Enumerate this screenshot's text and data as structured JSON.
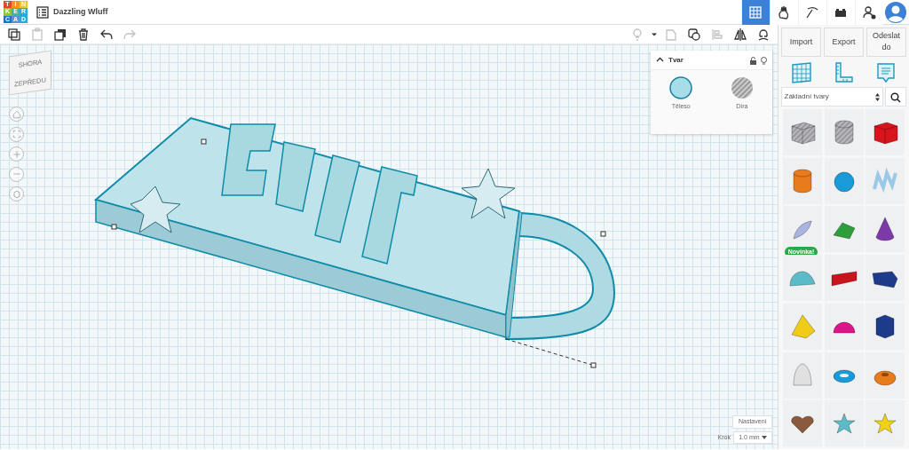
{
  "header": {
    "logo": [
      {
        "letter": "T",
        "color": "#e8432f"
      },
      {
        "letter": "I",
        "color": "#f7941d"
      },
      {
        "letter": "N",
        "color": "#f5c518"
      },
      {
        "letter": "K",
        "color": "#8cc63f"
      },
      {
        "letter": "E",
        "color": "#3cb4a0"
      },
      {
        "letter": "R",
        "color": "#27a9e1"
      },
      {
        "letter": "C",
        "color": "#1c75bc"
      },
      {
        "letter": "A",
        "color": "#5d8fd4"
      },
      {
        "letter": "D",
        "color": "#2aa9d8"
      }
    ],
    "project_title": "Dazzling Wluff",
    "modes": [
      {
        "kind": "grid",
        "selected": true
      },
      {
        "kind": "hand",
        "selected": false
      },
      {
        "kind": "pickaxe",
        "selected": false
      },
      {
        "kind": "brick",
        "selected": false
      },
      {
        "kind": "user-add",
        "selected": false
      }
    ]
  },
  "toolbar": {
    "left": [
      {
        "kind": "copy",
        "disabled": false
      },
      {
        "kind": "paste",
        "disabled": true
      },
      {
        "kind": "duplicate",
        "disabled": false
      },
      {
        "kind": "delete",
        "disabled": false
      },
      {
        "kind": "undo",
        "disabled": false
      },
      {
        "kind": "redo",
        "disabled": true
      }
    ],
    "right": [
      {
        "kind": "bulb",
        "disabled": true
      },
      {
        "kind": "caret",
        "disabled": false
      },
      {
        "kind": "group",
        "disabled": true
      },
      {
        "kind": "ungroup",
        "disabled": false
      },
      {
        "kind": "align",
        "disabled": true
      },
      {
        "kind": "mirror",
        "disabled": false
      },
      {
        "kind": "magnet",
        "disabled": false
      }
    ],
    "actions": [
      "Import",
      "Export",
      "Odeslat do"
    ]
  },
  "inspector": {
    "title": "Tvar",
    "options": [
      {
        "label": "Těleso",
        "kind": "solid",
        "selected": true
      },
      {
        "label": "Díra",
        "kind": "hole",
        "selected": false
      }
    ]
  },
  "view_cube": {
    "top": "SHORA",
    "front": "ZEPŘEDU"
  },
  "nav_controls": [
    {
      "kind": "home"
    },
    {
      "kind": "fit"
    },
    {
      "kind": "zoom-in"
    },
    {
      "kind": "zoom-out"
    },
    {
      "kind": "perspective"
    }
  ],
  "footer": {
    "settings": "Nastavení",
    "step_label": "Krok",
    "step_value": "1.0 mm"
  },
  "library": {
    "tabs": [
      {
        "kind": "workplane"
      },
      {
        "kind": "ruler"
      },
      {
        "kind": "notes"
      }
    ],
    "category": "Základní tvary",
    "shapes": [
      {
        "kind": "box",
        "color": "#b8b8be",
        "hatched": true
      },
      {
        "kind": "cylinder",
        "color": "#b8b8be",
        "hatched": true
      },
      {
        "kind": "box",
        "color": "#d8141d",
        "hatched": false
      },
      {
        "kind": "cylinder",
        "color": "#e87b1c",
        "hatched": false
      },
      {
        "kind": "sphere",
        "color": "#1a9ad6",
        "hatched": false
      },
      {
        "kind": "scribble",
        "color": "#9cc8e8",
        "hatched": false
      },
      {
        "kind": "pen",
        "color": "#a9b4e0",
        "hatched": false,
        "badge": "Novinka!"
      },
      {
        "kind": "roof",
        "color": "#2e9e3a",
        "hatched": false
      },
      {
        "kind": "cone",
        "color": "#7b3aa8",
        "hatched": false
      },
      {
        "kind": "halfcyl",
        "color": "#5bbcc8",
        "hatched": false
      },
      {
        "kind": "text",
        "color": "#c8141d",
        "hatched": false
      },
      {
        "kind": "wedge",
        "color": "#1e3a8a",
        "hatched": false
      },
      {
        "kind": "pyramid",
        "color": "#f0cc18",
        "hatched": false
      },
      {
        "kind": "hemisphere",
        "color": "#e0148a",
        "hatched": false
      },
      {
        "kind": "prism",
        "color": "#1e3a8a",
        "hatched": false
      },
      {
        "kind": "paraboloid",
        "color": "#e0e0e0",
        "hatched": false
      },
      {
        "kind": "torus",
        "color": "#1a9ad6",
        "hatched": false
      },
      {
        "kind": "tube",
        "color": "#e87b1c",
        "hatched": false
      },
      {
        "kind": "heart",
        "color": "#8b5a3c",
        "hatched": false
      },
      {
        "kind": "star",
        "color": "#5bbcc8",
        "hatched": false
      },
      {
        "kind": "star",
        "color": "#f0d018",
        "hatched": false
      }
    ]
  }
}
